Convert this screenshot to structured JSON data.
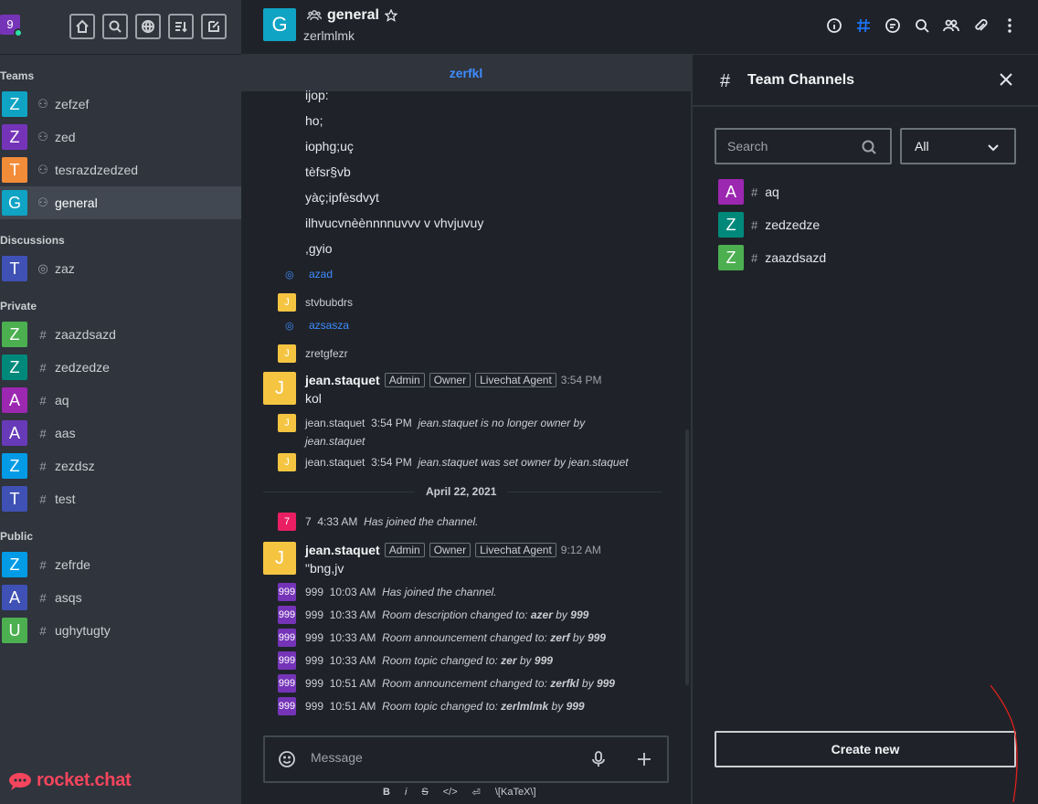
{
  "user": {
    "avatar_letter": "9",
    "avatar_color": "#7534b8"
  },
  "sidebar": {
    "sections": {
      "teams": "Teams",
      "discussions": "Discussions",
      "private": "Private",
      "public": "Public"
    },
    "teams": [
      {
        "letter": "Z",
        "color": "#0fa3c4",
        "label": "zefzef"
      },
      {
        "letter": "Z",
        "color": "#7534b8",
        "label": "zed"
      },
      {
        "letter": "T",
        "color": "#f38c39",
        "label": "tesrazdzedzed"
      },
      {
        "letter": "G",
        "color": "#0fa3c4",
        "label": "general"
      }
    ],
    "discussions": [
      {
        "letter": "T",
        "color": "#3f51b5",
        "label": "zaz"
      }
    ],
    "private": [
      {
        "letter": "Z",
        "color": "#4caf50",
        "label": "zaazdsazd"
      },
      {
        "letter": "Z",
        "color": "#00897b",
        "label": "zedzedze"
      },
      {
        "letter": "A",
        "color": "#9c27b0",
        "label": "aq"
      },
      {
        "letter": "A",
        "color": "#673ab7",
        "label": "aas"
      },
      {
        "letter": "Z",
        "color": "#039be5",
        "label": "zezdsz"
      },
      {
        "letter": "T",
        "color": "#3f51b5",
        "label": "test"
      }
    ],
    "public": [
      {
        "letter": "Z",
        "color": "#039be5",
        "label": "zefrde"
      },
      {
        "letter": "A",
        "color": "#3f51b5",
        "label": "asqs"
      },
      {
        "letter": "U",
        "color": "#4caf50",
        "label": "ughytugty"
      }
    ],
    "logo_text": "rocket.chat"
  },
  "header": {
    "avatar_letter": "G",
    "room_name": "general",
    "topic": "zerlmlmk"
  },
  "announcement": "zerfkl",
  "messages": {
    "lines": [
      "ijop:",
      "ho;",
      "iophg;uç",
      "tèfsr§vb",
      "yàç;ipfèsdvyt",
      "ilhvucvnèènnnnuvvv v vhvjuvuy",
      ",gyio"
    ],
    "thread1": "azad",
    "j1_user": "J",
    "j1_text": "stvbubdrs",
    "thread2": "azsasza",
    "j2_user": "J",
    "j2_text": "zretgfezr",
    "full1": {
      "user": "jean.staquet",
      "tags": [
        "Admin",
        "Owner",
        "Livechat Agent"
      ],
      "time": "3:54 PM",
      "body": "kol"
    },
    "sys1": {
      "user": "jean.staquet",
      "time": "3:54 PM",
      "text": "jean.staquet is no longer owner by",
      "text2": "jean.staquet"
    },
    "sys2": {
      "user": "jean.staquet",
      "time": "3:54 PM",
      "text": "jean.staquet was set owner by jean.staquet"
    },
    "date_divider": "April 22, 2021",
    "sys3": {
      "user": "7",
      "time": "4:33 AM",
      "text": "Has joined the channel."
    },
    "full2": {
      "user": "jean.staquet",
      "tags": [
        "Admin",
        "Owner",
        "Livechat Agent"
      ],
      "time": "9:12 AM",
      "body": "\"bng,jv"
    },
    "system": [
      {
        "user": "999",
        "time": "10:03 AM",
        "text": "Has joined the channel.",
        "bold": "",
        "by": ""
      },
      {
        "user": "999",
        "time": "10:33 AM",
        "text": "Room description changed to:",
        "bold": "azer",
        "by": "999"
      },
      {
        "user": "999",
        "time": "10:33 AM",
        "text": "Room announcement changed to:",
        "bold": "zerf",
        "by": "999"
      },
      {
        "user": "999",
        "time": "10:33 AM",
        "text": "Room topic changed to:",
        "bold": "zer",
        "by": "999"
      },
      {
        "user": "999",
        "time": "10:51 AM",
        "text": "Room announcement changed to:",
        "bold": "zerfkl",
        "by": "999"
      },
      {
        "user": "999",
        "time": "10:51 AM",
        "text": "Room topic changed to:",
        "bold": "zerlmlmk",
        "by": "999"
      }
    ],
    "by_word": "by"
  },
  "composer": {
    "placeholder": "Message",
    "format": [
      "B",
      "i",
      "S",
      "</>",
      "⏎",
      "\\[KaTeX\\]"
    ]
  },
  "panel": {
    "title": "Team Channels",
    "search_placeholder": "Search",
    "filter_value": "All",
    "channels": [
      {
        "letter": "A",
        "color": "#9c27b0",
        "label": "aq"
      },
      {
        "letter": "Z",
        "color": "#00897b",
        "label": "zedzedze"
      },
      {
        "letter": "Z",
        "color": "#4caf50",
        "label": "zaazdsazd"
      }
    ],
    "create_label": "Create new"
  }
}
